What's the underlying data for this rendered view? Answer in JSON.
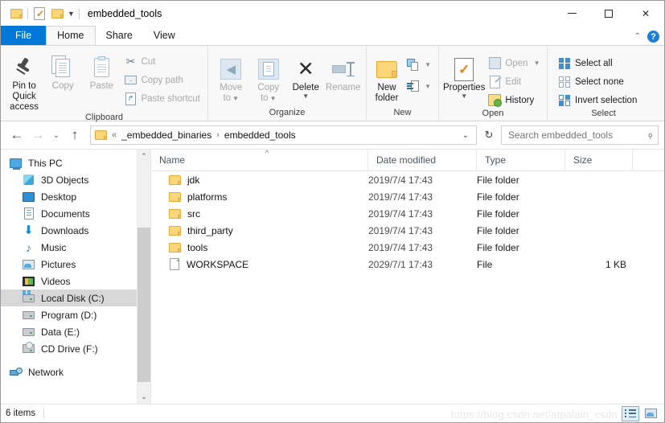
{
  "window": {
    "title": "embedded_tools",
    "quick_access": [
      "folder-icon",
      "properties-icon",
      "new-folder-icon",
      "customize-caret"
    ],
    "controls": {
      "minimize": "minimize-icon",
      "maximize": "maximize-icon",
      "close": "✕"
    }
  },
  "ribbon": {
    "tabs": [
      {
        "label": "File",
        "active": false,
        "style": "file"
      },
      {
        "label": "Home",
        "active": true,
        "style": "normal"
      },
      {
        "label": "Share",
        "active": false,
        "style": "normal"
      },
      {
        "label": "View",
        "active": false,
        "style": "normal"
      }
    ],
    "collapse_icon": "chevron-up-icon",
    "help_icon": "?",
    "groups": [
      {
        "label": "Clipboard",
        "big": [
          {
            "label": "Pin to Quick\naccess",
            "line1": "Pin to Quick",
            "line2": "access",
            "disabled": false
          },
          {
            "label": "Copy",
            "line1": "Copy",
            "line2": "",
            "disabled": true
          },
          {
            "label": "Paste",
            "line1": "Paste",
            "line2": "",
            "disabled": true
          }
        ],
        "small": [
          {
            "label": "Cut",
            "disabled": true
          },
          {
            "label": "Copy path",
            "disabled": true
          },
          {
            "label": "Paste shortcut",
            "disabled": true
          }
        ]
      },
      {
        "label": "Organize",
        "big": [
          {
            "line1": "Move",
            "line2": "to",
            "disabled": true,
            "caret": true
          },
          {
            "line1": "Copy",
            "line2": "to",
            "disabled": true,
            "caret": true
          },
          {
            "line1": "Delete",
            "line2": "",
            "disabled": false,
            "caret": true
          },
          {
            "line1": "Rename",
            "line2": "",
            "disabled": true,
            "caret": false
          }
        ],
        "small": []
      },
      {
        "label": "New",
        "big": [
          {
            "line1": "New",
            "line2": "folder",
            "disabled": false
          }
        ],
        "small": [
          {
            "label": "new-item-icon",
            "disabled": false
          },
          {
            "label": "easy-access-icon",
            "disabled": false
          }
        ]
      },
      {
        "label": "Open",
        "big": [
          {
            "line1": "Properties",
            "line2": "",
            "disabled": false,
            "caret": true
          }
        ],
        "small": [
          {
            "label": "Open",
            "disabled": true,
            "caret": true
          },
          {
            "label": "Edit",
            "disabled": true
          },
          {
            "label": "History",
            "disabled": false
          }
        ]
      },
      {
        "label": "Select",
        "big": [],
        "small": [
          {
            "label": "Select all",
            "disabled": false
          },
          {
            "label": "Select none",
            "disabled": false
          },
          {
            "label": "Invert selection",
            "disabled": false
          }
        ]
      }
    ]
  },
  "address": {
    "back_icon": "←",
    "forward_icon": "→",
    "recent_icon": "⌄",
    "up_icon": "↑",
    "overflow": "«",
    "crumbs": [
      "_embedded_binaries",
      "embedded_tools"
    ],
    "separator": "›",
    "dropdown_icon": "⌄",
    "refresh_icon": "↻"
  },
  "search": {
    "placeholder": "Search embedded_tools",
    "value": "",
    "icon": "search-icon"
  },
  "sidebar": {
    "items": [
      {
        "label": "This PC",
        "icon": "this-pc-icon",
        "indent": false,
        "selected": false
      },
      {
        "label": "3D Objects",
        "icon": "3d-objects-icon",
        "indent": true,
        "selected": false
      },
      {
        "label": "Desktop",
        "icon": "desktop-icon",
        "indent": true,
        "selected": false
      },
      {
        "label": "Documents",
        "icon": "documents-icon",
        "indent": true,
        "selected": false
      },
      {
        "label": "Downloads",
        "icon": "downloads-icon",
        "indent": true,
        "selected": false
      },
      {
        "label": "Music",
        "icon": "music-icon",
        "indent": true,
        "selected": false
      },
      {
        "label": "Pictures",
        "icon": "pictures-icon",
        "indent": true,
        "selected": false
      },
      {
        "label": "Videos",
        "icon": "videos-icon",
        "indent": true,
        "selected": false
      },
      {
        "label": "Local Disk (C:)",
        "icon": "system-drive-icon",
        "indent": true,
        "selected": true
      },
      {
        "label": "Program (D:)",
        "icon": "drive-icon",
        "indent": true,
        "selected": false
      },
      {
        "label": "Data (E:)",
        "icon": "drive-icon",
        "indent": true,
        "selected": false
      },
      {
        "label": "CD Drive (F:)",
        "icon": "cd-drive-icon",
        "indent": true,
        "selected": false
      },
      {
        "label": "Network",
        "icon": "network-icon",
        "indent": false,
        "selected": false
      }
    ]
  },
  "filelist": {
    "columns": [
      "Name",
      "Date modified",
      "Type",
      "Size"
    ],
    "sort_indicator": "^",
    "rows": [
      {
        "name": "jdk",
        "date": "2019/7/4 17:43",
        "type": "File folder",
        "size": "",
        "kind": "folder"
      },
      {
        "name": "platforms",
        "date": "2019/7/4 17:43",
        "type": "File folder",
        "size": "",
        "kind": "folder"
      },
      {
        "name": "src",
        "date": "2019/7/4 17:43",
        "type": "File folder",
        "size": "",
        "kind": "folder"
      },
      {
        "name": "third_party",
        "date": "2019/7/4 17:43",
        "type": "File folder",
        "size": "",
        "kind": "folder"
      },
      {
        "name": "tools",
        "date": "2019/7/4 17:43",
        "type": "File folder",
        "size": "",
        "kind": "folder"
      },
      {
        "name": "WORKSPACE",
        "date": "2029/7/1 17:43",
        "type": "File",
        "size": "1 KB",
        "kind": "file"
      }
    ]
  },
  "status": {
    "item_count": "6 items",
    "details_view": "details-view-icon",
    "thumbnail_view": "large-icons-view-icon"
  },
  "watermark": "https://blog.csdn.net/atpalain_csdn",
  "colors": {
    "accent": "#0078d7",
    "folder": "#fcd67a",
    "selection": "#d8d8d8",
    "help": "#1a7fd4"
  }
}
